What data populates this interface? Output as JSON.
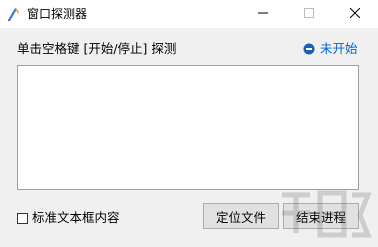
{
  "window": {
    "title": "窗口探测器",
    "icon": "pen-tool-icon"
  },
  "controls": {
    "minimize_icon": "minimize-icon",
    "maximize_icon": "maximize-icon",
    "close_icon": "close-icon"
  },
  "main": {
    "hint_text": "单击空格键 [开始/停止] 探测",
    "status": {
      "text": "未开始",
      "icon": "stop-circle-icon",
      "color": "#0066cc"
    },
    "output_text": ""
  },
  "footer": {
    "checkbox_label": "标准文本框内容",
    "checkbox_checked": false,
    "locate_button": "定位文件",
    "end_button": "结束进程"
  },
  "colors": {
    "client_bg": "#f0f0f0",
    "accent": "#0066cc"
  }
}
